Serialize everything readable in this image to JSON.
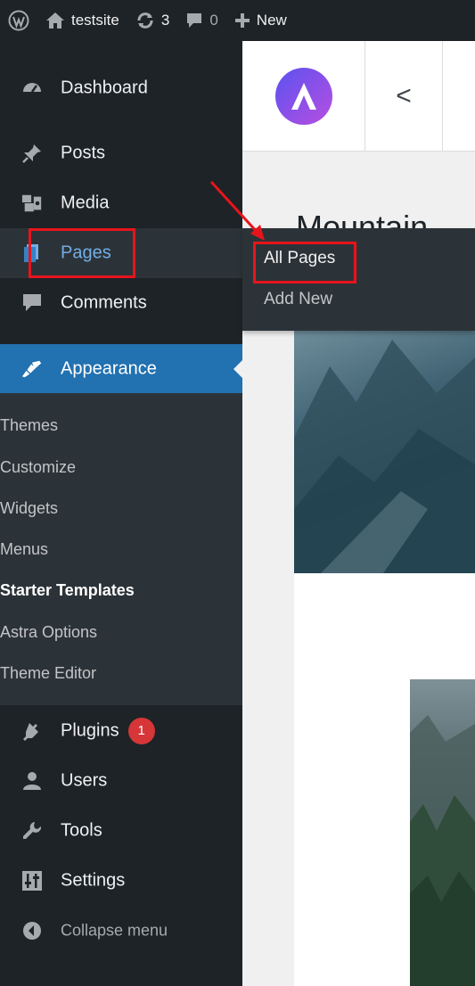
{
  "admin_bar": {
    "wp_logo_icon": "wordpress-logo-icon",
    "site_name": "testsite",
    "updates_count": "3",
    "comments_count": "0",
    "new_label": "New"
  },
  "sidebar": {
    "items": [
      {
        "label": "Dashboard",
        "icon": "dashboard-icon"
      },
      {
        "label": "Posts",
        "icon": "pin-icon"
      },
      {
        "label": "Media",
        "icon": "media-icon"
      },
      {
        "label": "Pages",
        "icon": "pages-icon"
      },
      {
        "label": "Comments",
        "icon": "comment-icon"
      },
      {
        "label": "Appearance",
        "icon": "brush-icon"
      },
      {
        "label": "Plugins",
        "icon": "plugin-icon",
        "badge": "1"
      },
      {
        "label": "Users",
        "icon": "users-icon"
      },
      {
        "label": "Tools",
        "icon": "wrench-icon"
      },
      {
        "label": "Settings",
        "icon": "settings-icon"
      },
      {
        "label": "Collapse menu",
        "icon": "collapse-icon"
      }
    ],
    "appearance_submenu": [
      "Themes",
      "Customize",
      "Widgets",
      "Menus",
      "Starter Templates",
      "Astra Options",
      "Theme Editor"
    ]
  },
  "pages_flyout": {
    "items": [
      "All Pages",
      "Add New"
    ]
  },
  "content": {
    "back_symbol": "<",
    "heading": "Mountain"
  },
  "colors": {
    "admin_bg": "#1d2327",
    "accent": "#2271b1",
    "highlight_text": "#72aee6",
    "annotation_red": "#e8141b",
    "badge_red": "#d63638"
  }
}
